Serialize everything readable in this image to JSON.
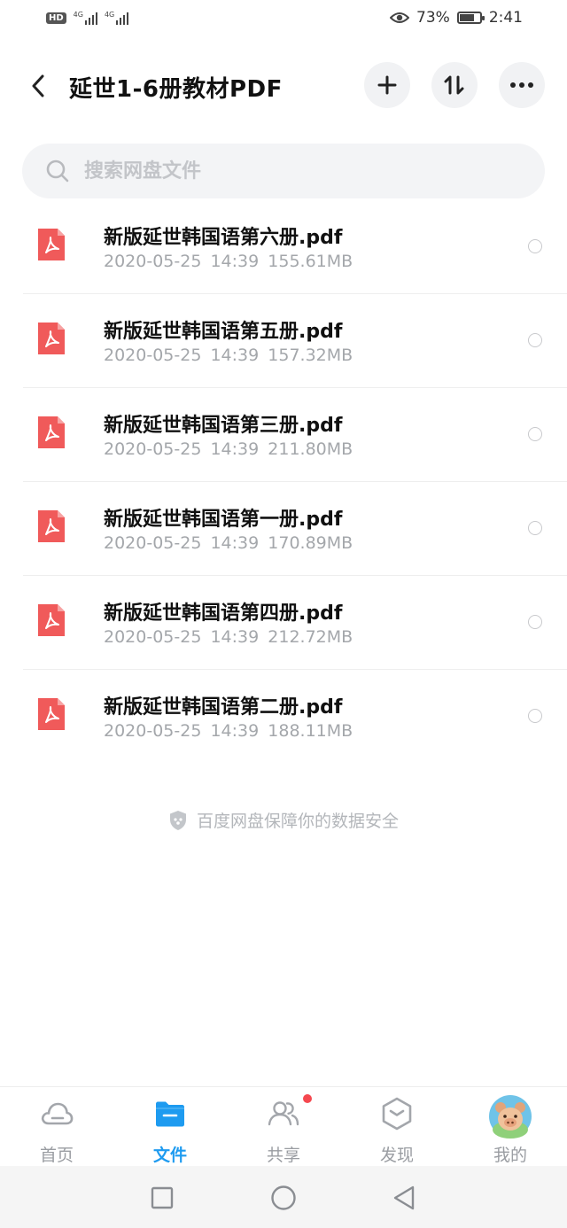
{
  "status_bar": {
    "hd_badge": "HD",
    "signal_1_label": "4G",
    "signal_2_label": "4G",
    "battery_percent": "73%",
    "battery_level": 0.73,
    "time": "2:41"
  },
  "header": {
    "title": "延世1-6册教材PDF",
    "back_icon": "chevron-left-icon",
    "add_icon": "plus-icon",
    "sort_icon": "sort-icon",
    "more_icon": "more-icon"
  },
  "search": {
    "placeholder": "搜索网盘文件",
    "value": ""
  },
  "files": [
    {
      "name": "新版延世韩国语第六册.pdf",
      "date": "2020-05-25",
      "time": "14:39",
      "size": "155.61MB"
    },
    {
      "name": "新版延世韩国语第五册.pdf",
      "date": "2020-05-25",
      "time": "14:39",
      "size": "157.32MB"
    },
    {
      "name": "新版延世韩国语第三册.pdf",
      "date": "2020-05-25",
      "time": "14:39",
      "size": "211.80MB"
    },
    {
      "name": "新版延世韩国语第一册.pdf",
      "date": "2020-05-25",
      "time": "14:39",
      "size": "170.89MB"
    },
    {
      "name": "新版延世韩国语第四册.pdf",
      "date": "2020-05-25",
      "time": "14:39",
      "size": "212.72MB"
    },
    {
      "name": "新版延世韩国语第二册.pdf",
      "date": "2020-05-25",
      "time": "14:39",
      "size": "188.11MB"
    }
  ],
  "safety_note": "百度网盘保障你的数据安全",
  "tabs": [
    {
      "label": "首页",
      "icon": "cloud-icon"
    },
    {
      "label": "文件",
      "icon": "folder-icon",
      "active": true
    },
    {
      "label": "共享",
      "icon": "people-icon",
      "badge": true
    },
    {
      "label": "发现",
      "icon": "discover-icon"
    },
    {
      "label": "我的",
      "icon": "avatar-icon"
    }
  ],
  "colors": {
    "accent": "#1e9bf0",
    "pdf_red": "#f05a5a",
    "badge_red": "#f5484f"
  }
}
